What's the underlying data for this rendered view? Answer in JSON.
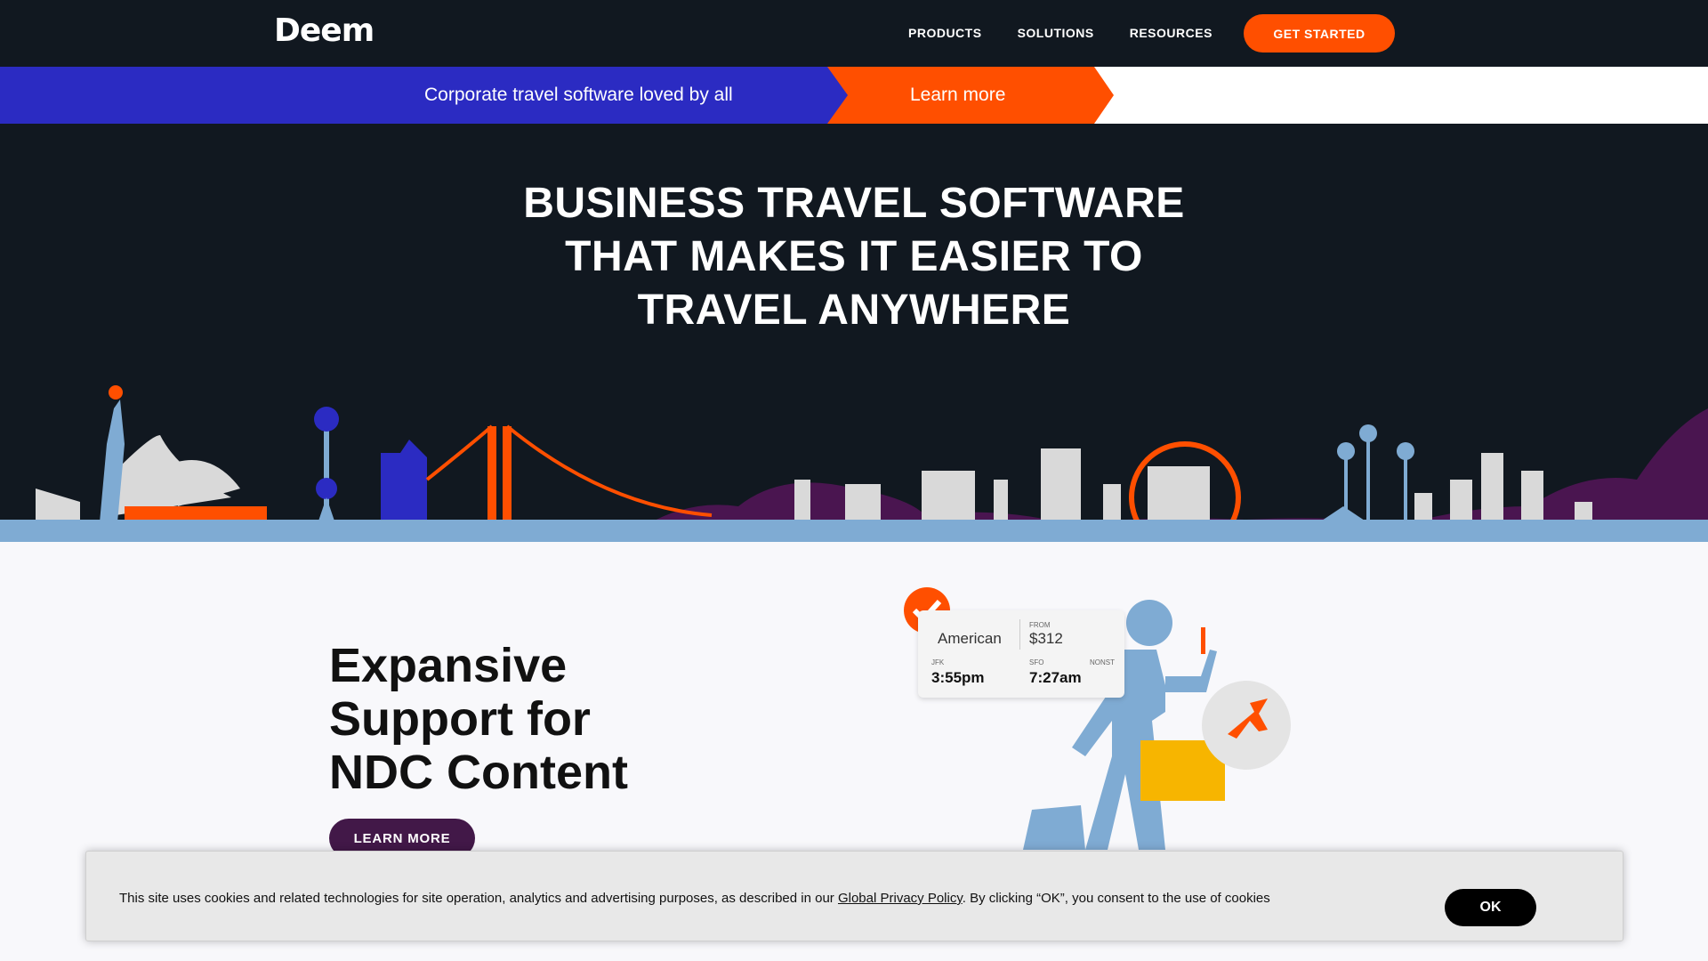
{
  "nav": {
    "logo": "Deem",
    "links": [
      "PRODUCTS",
      "SOLUTIONS",
      "RESOURCES"
    ],
    "cta": "GET STARTED"
  },
  "banner": {
    "text": "Corporate travel software loved by all",
    "link": "Learn more"
  },
  "hero": {
    "title_lines": [
      "BUSINESS TRAVEL SOFTWARE",
      "THAT MAKES IT EASIER TO",
      "TRAVEL ANYWHERE"
    ]
  },
  "feature": {
    "title_lines": [
      "Expansive",
      "Support for",
      "NDC Content"
    ],
    "button": "LEARN MORE"
  },
  "flight_card": {
    "airline": "American",
    "from_label": "FROM",
    "price": "$312",
    "origin": "JFK",
    "depart": "3:55pm",
    "dest": "SFO",
    "arrive": "7:27am",
    "stops": "NONST"
  },
  "cookie": {
    "text_before": "This site uses cookies and related technologies for site operation, analytics and advertising purposes, as described in our ",
    "link": "Global Privacy Policy",
    "text_after": ". By clicking “OK”, you consent to the use of cookies",
    "ok": "OK"
  },
  "colors": {
    "nav_bg": "#111820",
    "accent_orange": "#ff4f00",
    "banner_blue": "#2b2bc2",
    "purple": "#421848",
    "sky_blue": "#7fabd3"
  }
}
